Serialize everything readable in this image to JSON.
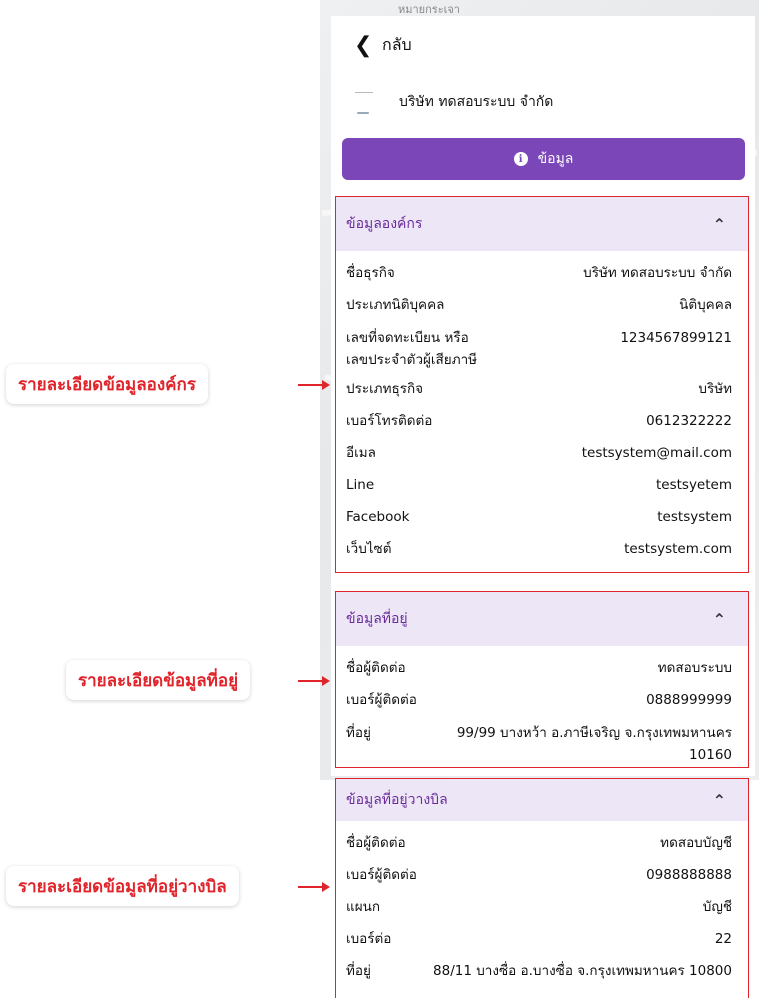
{
  "header": {
    "back_label": "กลับ",
    "company_name": "บริษัท ทดสอบระบบ จำกัด"
  },
  "info_button": {
    "label": "ข้อมูล",
    "icon": "info-icon"
  },
  "map_label": "หมายกระเจา",
  "sections": [
    {
      "title": "ข้อมูลองค์กร",
      "rows": [
        {
          "label": "ชื่อธุรกิจ",
          "value": "บริษัท ทดสอบระบบ จำกัด"
        },
        {
          "label": "ประเภทนิติบุคคล",
          "value": "นิติบุคคล"
        },
        {
          "label": "เลขที่จดทะเบียน หรือ\nเลขประจำตัวผู้เสียภาษี",
          "value": "1234567899121"
        },
        {
          "label": "ประเภทธุรกิจ",
          "value": "บริษัท"
        },
        {
          "label": "เบอร์โทรติดต่อ",
          "value": "0612322222"
        },
        {
          "label": "อีเมล",
          "value": "testsystem@mail.com"
        },
        {
          "label": "Line",
          "value": "testsyetem"
        },
        {
          "label": "Facebook",
          "value": "testsystem"
        },
        {
          "label": "เว็บไซต์",
          "value": "testsystem.com"
        }
      ]
    },
    {
      "title": "ข้อมูลที่อยู่",
      "rows": [
        {
          "label": "ชื่อผู้ติดต่อ",
          "value": "ทดสอบระบบ"
        },
        {
          "label": "เบอร์ผู้ติดต่อ",
          "value": "0888999999"
        },
        {
          "label": "ที่อยู่",
          "value": "99/99 บางหว้า อ.ภาษีเจริญ จ.กรุงเทพมหานคร\n10160"
        }
      ]
    },
    {
      "title": "ข้อมูลที่อยู่วางบิล",
      "rows": [
        {
          "label": "ชื่อผู้ติดต่อ",
          "value": "ทดสอบบัญชี"
        },
        {
          "label": "เบอร์ผู้ติดต่อ",
          "value": "0988888888"
        },
        {
          "label": "แผนก",
          "value": "บัญชี"
        },
        {
          "label": "เบอร์ต่อ",
          "value": "22"
        },
        {
          "label": "ที่อยู่",
          "value": "88/11 บางซื่อ อ.บางซื่อ จ.กรุงเทพมหานคร 10800"
        }
      ]
    }
  ],
  "callouts": [
    "รายละเอียดข้อมูลองค์กร",
    "รายละเอียดข้อมูลที่อยู่",
    "รายละเอียดข้อมูลที่อยู่วางบิล"
  ],
  "colors": {
    "primary": "#7b46b8",
    "section_header_bg": "#ece6f6",
    "highlight": "#e0242b"
  }
}
